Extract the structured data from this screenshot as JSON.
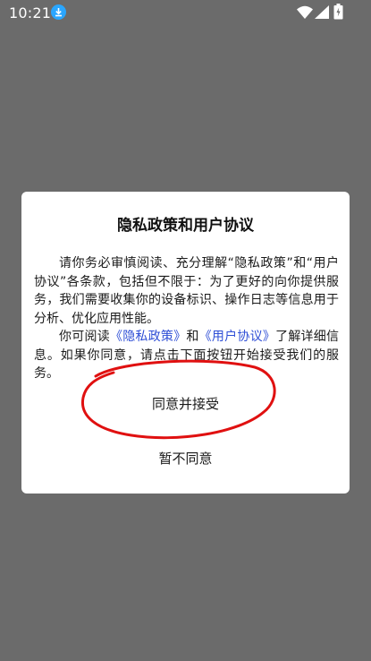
{
  "status_bar": {
    "time": "10:21"
  },
  "dialog": {
    "title": "隐私政策和用户协议",
    "paragraph1": "请你务必审慎阅读、充分理解“隐私政策”和“用户协议”各条款，包括但不限于：为了更好的向你提供服务，我们需要收集你的设备标识、操作日志等信息用于分析、优化应用性能。",
    "paragraph2_prefix": "你可阅读",
    "privacy_link": "《隐私政策》",
    "paragraph2_and": "和",
    "terms_link": "《用户协议》",
    "paragraph2_suffix": "了解详细信息。如果你同意，请点击下面按钮开始接受我们的服务。",
    "accept_label": "同意并接受",
    "decline_label": "暂不同意"
  },
  "colors": {
    "overlay": "#6b6b6b",
    "dialog_bg": "#ffffff",
    "link": "#2f4fd6",
    "annotation": "#e01010",
    "download_badge": "#2aa6ff"
  },
  "icons": [
    "download-icon",
    "wifi-icon",
    "signal-icon",
    "battery-icon"
  ]
}
